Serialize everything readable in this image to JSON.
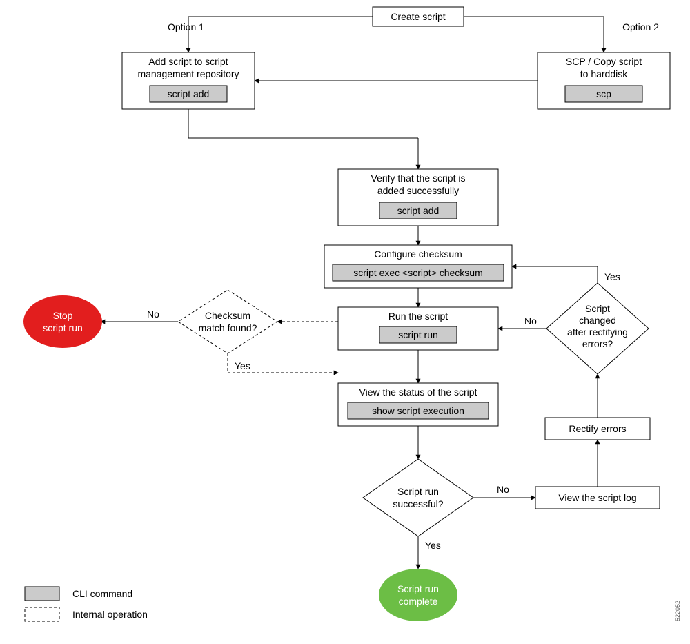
{
  "chart_data": {
    "type": "flowchart",
    "start": "create_script",
    "nodes": {
      "create_script": {
        "kind": "process",
        "text": "Create script"
      },
      "add_script": {
        "kind": "process",
        "text": "Add script to script management repository",
        "cli": "script add"
      },
      "scp_copy": {
        "kind": "process",
        "text": "SCP / Copy script to harddisk",
        "cli": "scp"
      },
      "verify_added": {
        "kind": "process",
        "text": "Verify that the script is added successfully",
        "cli": "script add"
      },
      "configure_checksum": {
        "kind": "process",
        "text": "Configure checksum",
        "cli": "script exec <script> checksum"
      },
      "run_script": {
        "kind": "process",
        "text": "Run the script",
        "cli": "script run"
      },
      "checksum_match": {
        "kind": "decision",
        "text": "Checksum match found?",
        "internal": true
      },
      "stop_run": {
        "kind": "terminator",
        "text": "Stop script run",
        "color": "red"
      },
      "view_status": {
        "kind": "process",
        "text": "View the status of the script",
        "cli": "show script execution"
      },
      "run_successful": {
        "kind": "decision",
        "text": "Script run successful?"
      },
      "view_log": {
        "kind": "process",
        "text": "View the script log"
      },
      "rectify_errors": {
        "kind": "process",
        "text": "Rectify errors"
      },
      "script_changed": {
        "kind": "decision",
        "text": "Script changed after rectifying errors?"
      },
      "complete": {
        "kind": "terminator",
        "text": "Script run complete",
        "color": "green"
      }
    },
    "edges": [
      {
        "from": "create_script",
        "to": "add_script",
        "label": "Option 1"
      },
      {
        "from": "create_script",
        "to": "scp_copy",
        "label": "Option 2"
      },
      {
        "from": "scp_copy",
        "to": "add_script"
      },
      {
        "from": "add_script",
        "to": "verify_added"
      },
      {
        "from": "verify_added",
        "to": "configure_checksum"
      },
      {
        "from": "configure_checksum",
        "to": "run_script"
      },
      {
        "from": "run_script",
        "to": "checksum_match",
        "internal": true
      },
      {
        "from": "checksum_match",
        "to": "stop_run",
        "label": "No",
        "internal": true
      },
      {
        "from": "checksum_match",
        "to": "run_script",
        "label": "Yes",
        "internal": true
      },
      {
        "from": "run_script",
        "to": "view_status"
      },
      {
        "from": "view_status",
        "to": "run_successful"
      },
      {
        "from": "run_successful",
        "to": "complete",
        "label": "Yes"
      },
      {
        "from": "run_successful",
        "to": "view_log",
        "label": "No"
      },
      {
        "from": "view_log",
        "to": "rectify_errors"
      },
      {
        "from": "rectify_errors",
        "to": "script_changed"
      },
      {
        "from": "script_changed",
        "to": "configure_checksum",
        "label": "Yes"
      },
      {
        "from": "script_changed",
        "to": "run_script",
        "label": "No"
      }
    ]
  },
  "nodes": {
    "create_script": {
      "label": "Create script"
    },
    "option1": {
      "label": "Option 1"
    },
    "option2": {
      "label": "Option 2"
    },
    "add_script": {
      "line1": "Add script to script",
      "line2": "management repository",
      "cmd": "script add"
    },
    "scp_copy": {
      "line1": "SCP / Copy script",
      "line2": "to harddisk",
      "cmd": "scp"
    },
    "verify_added": {
      "line1": "Verify that the script is",
      "line2": "added successfully",
      "cmd": "script add"
    },
    "configure_checksum": {
      "label": "Configure checksum",
      "cmd": "script exec <script> checksum"
    },
    "run_script": {
      "label": "Run the script",
      "cmd": "script run"
    },
    "checksum": {
      "line1": "Checksum",
      "line2": "match found?"
    },
    "stop": {
      "line1": "Stop",
      "line2": "script run"
    },
    "view_status": {
      "label": "View the status of the script",
      "cmd": "show script execution"
    },
    "run_successful": {
      "line1": "Script run",
      "line2": "successful?"
    },
    "view_log": {
      "label": "View the script log"
    },
    "rectify": {
      "label": "Rectify errors"
    },
    "script_changed": {
      "line1": "Script",
      "line2": "changed",
      "line3": "after rectifying",
      "line4": "errors?"
    },
    "complete": {
      "line1": "Script run",
      "line2": "complete"
    }
  },
  "labels": {
    "no": "No",
    "yes": "Yes"
  },
  "legend": {
    "cli": "CLI command",
    "internal": "Internal operation"
  },
  "figure_id": "522052"
}
